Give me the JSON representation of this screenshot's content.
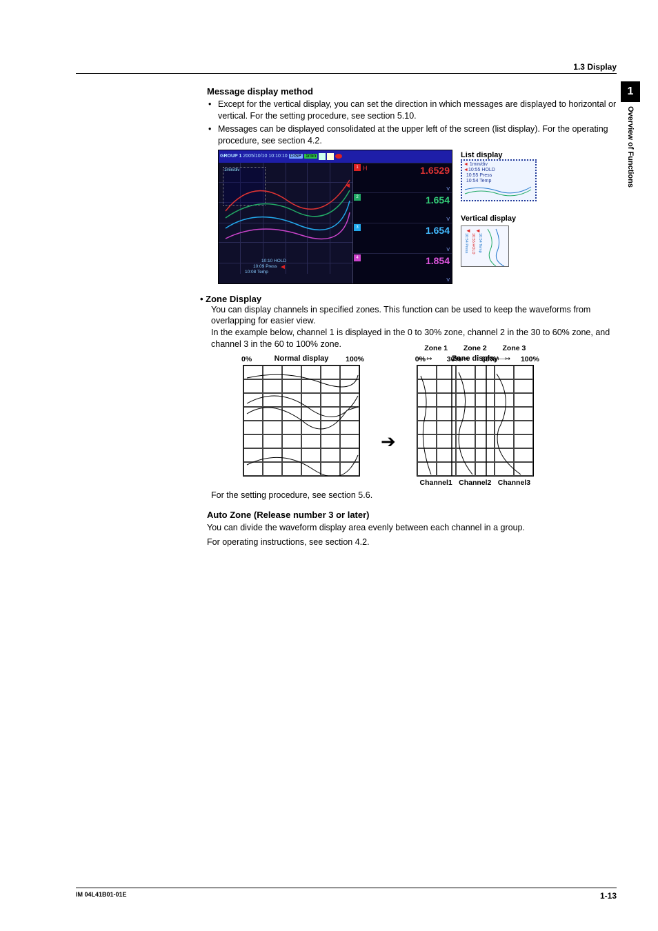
{
  "header": {
    "section": "1.3  Display"
  },
  "sidetab": {
    "num": "1",
    "title": "Overview of Functions"
  },
  "msg_method": {
    "heading": "Message display method",
    "bullets": [
      "Except for the vertical display, you can set the direction in which messages are displayed to horizontal or vertical. For the setting procedure, see section 5.10.",
      "Messages can be displayed consolidated at the upper left of the screen (list display). For the operating procedure, see section 4.2."
    ],
    "labels": {
      "list_display": "List display",
      "vertical_display": "Vertical display"
    }
  },
  "trend": {
    "group": "GROUP 1",
    "datetime": "2005/10/10 10:10:10",
    "disp": "DISP",
    "rate": "1min",
    "div_label": "1min/div",
    "list": {
      "line1": "10:55 HOLD",
      "line2": "10:55 Press",
      "line3": "10:54 Temp"
    },
    "events": {
      "hold": "10:10 HOLD",
      "press": "10:09 Press",
      "temp": "10:08 Temp"
    },
    "readouts": [
      {
        "tag": "1",
        "color": "#d22",
        "label": "H",
        "value": "1.6529",
        "unit": "V"
      },
      {
        "tag": "2",
        "color": "#2a6",
        "label": "",
        "value": "1.654",
        "unit": "V"
      },
      {
        "tag": "3",
        "color": "#2ae",
        "label": "",
        "value": "1.654",
        "unit": "V"
      },
      {
        "tag": "4",
        "color": "#c4c",
        "label": "",
        "value": "1.854",
        "unit": "V"
      }
    ],
    "vertical_mini": {
      "lbl1": "10:54  Press",
      "lbl2": "10:55  HOLD",
      "lbl3": "10:54  Temp"
    }
  },
  "zone": {
    "heading": "Zone Display",
    "p1": "You can display channels in specified zones. This function can be used to keep the waveforms from overlapping for easier view.",
    "p2": "In the example below, channel 1 is displayed in the 0 to 30% zone, channel 2 in the 30 to 60% zone, and channel 3 in the 60 to 100% zone.",
    "normal_title": "Normal display",
    "zone_title": "Zone display",
    "zones": [
      "Zone 1",
      "Zone 2",
      "Zone 3"
    ],
    "pct": [
      "0%",
      "30%",
      "60%",
      "100%"
    ],
    "scale0": "0%",
    "scale100": "100%",
    "channels": [
      "Channel1",
      "Channel2",
      "Channel3"
    ],
    "after": "For the setting procedure, see section 5.6."
  },
  "autozone": {
    "heading": "Auto Zone (Release number 3 or later)",
    "p1": "You can divide the waveform display area evenly between each channel in a group.",
    "p2": "For operating instructions, see section 4.2."
  },
  "footer": {
    "doc": "IM 04L41B01-01E",
    "page": "1-13"
  }
}
